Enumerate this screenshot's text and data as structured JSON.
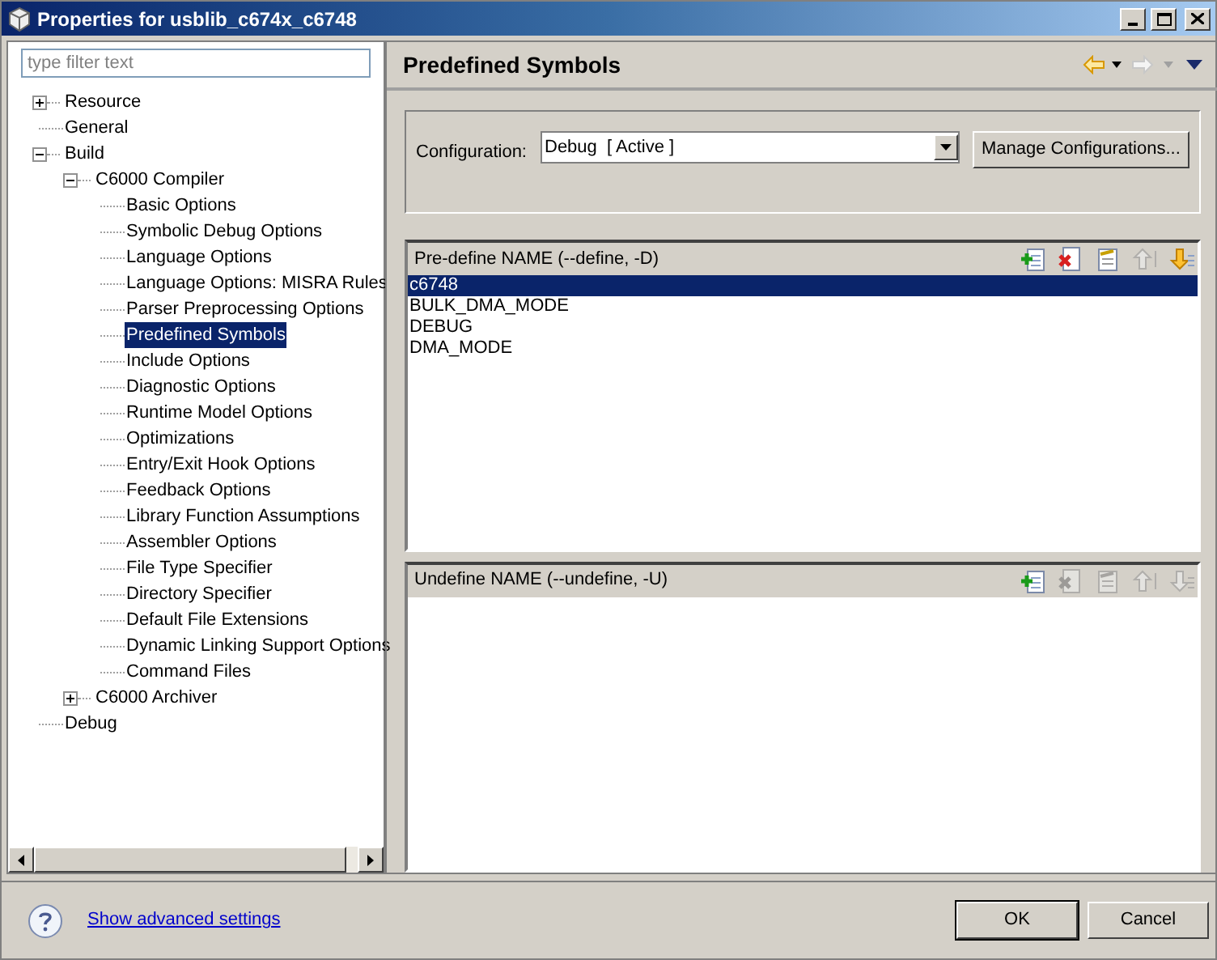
{
  "window": {
    "title": "Properties for usblib_c674x_c6748"
  },
  "filter": {
    "placeholder": "type filter text"
  },
  "tree": [
    {
      "label": "Resource",
      "expanded": false,
      "selected": false
    },
    {
      "label": "General",
      "selected": false
    },
    {
      "label": "Build",
      "expanded": true,
      "selected": false,
      "children": [
        {
          "label": "C6000 Compiler",
          "expanded": true,
          "selected": false,
          "children": [
            {
              "label": "Basic Options",
              "selected": false
            },
            {
              "label": "Symbolic Debug Options",
              "selected": false
            },
            {
              "label": "Language Options",
              "selected": false
            },
            {
              "label": "Language Options: MISRA Rules",
              "selected": false
            },
            {
              "label": "Parser Preprocessing Options",
              "selected": false
            },
            {
              "label": "Predefined Symbols",
              "selected": true
            },
            {
              "label": "Include Options",
              "selected": false
            },
            {
              "label": "Diagnostic Options",
              "selected": false
            },
            {
              "label": "Runtime Model Options",
              "selected": false
            },
            {
              "label": "Optimizations",
              "selected": false
            },
            {
              "label": "Entry/Exit Hook Options",
              "selected": false
            },
            {
              "label": "Feedback Options",
              "selected": false
            },
            {
              "label": "Library Function Assumptions",
              "selected": false
            },
            {
              "label": "Assembler Options",
              "selected": false
            },
            {
              "label": "File Type Specifier",
              "selected": false
            },
            {
              "label": "Directory Specifier",
              "selected": false
            },
            {
              "label": "Default File Extensions",
              "selected": false
            },
            {
              "label": "Dynamic Linking Support Options",
              "selected": false
            },
            {
              "label": "Command Files",
              "selected": false
            }
          ]
        },
        {
          "label": "C6000 Archiver",
          "expanded": false,
          "selected": false
        }
      ]
    },
    {
      "label": "Debug",
      "selected": false
    }
  ],
  "page": {
    "title": "Predefined Symbols"
  },
  "configuration": {
    "label": "Configuration:",
    "value": "Debug  [ Active ]",
    "button": "Manage Configurations..."
  },
  "lists": [
    {
      "title": "Pre-define NAME (--define, -D)",
      "tools": [
        {
          "kind": "add",
          "disabled": false
        },
        {
          "kind": "delete",
          "disabled": false
        },
        {
          "kind": "edit",
          "disabled": false
        },
        {
          "kind": "up",
          "disabled": true
        },
        {
          "kind": "down",
          "disabled": false
        }
      ],
      "items": [
        {
          "label": "c6748",
          "selected": true
        },
        {
          "label": "BULK_DMA_MODE",
          "selected": false
        },
        {
          "label": "DEBUG",
          "selected": false
        },
        {
          "label": "DMA_MODE",
          "selected": false
        }
      ]
    },
    {
      "title": "Undefine NAME (--undefine, -U)",
      "tools": [
        {
          "kind": "add",
          "disabled": false
        },
        {
          "kind": "delete",
          "disabled": true
        },
        {
          "kind": "edit",
          "disabled": true
        },
        {
          "kind": "up",
          "disabled": true
        },
        {
          "kind": "down",
          "disabled": true
        }
      ]
    }
  ],
  "footer": {
    "link": "Show advanced settings",
    "buttons": [
      "OK",
      "Cancel"
    ]
  }
}
